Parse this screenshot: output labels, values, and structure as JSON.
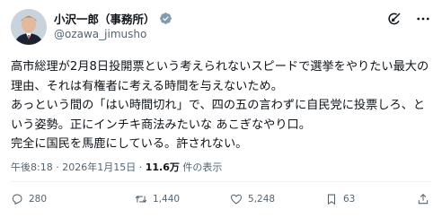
{
  "post": {
    "author_name": "小沢一郎（事務所）",
    "handle": "@ozawa_jimusho",
    "text": "高市総理が2月8日投開票という考えられないスピードで選挙をやりたい最大の理由、それは有権者に考える時間を与えないため。\nあっという間の「はい時間切れ」で、四の五の言わずに自民党に投票しろ、という姿勢。正にインチキ商法みたいな あこぎなやり口。\n完全に国民を馬鹿にしている。許されない。",
    "time": "午後8:18",
    "date": "2026年1月15日",
    "views_count": "11.6万",
    "views_suffix": "件の表示",
    "separator": "·"
  },
  "actions": {
    "replies": "280",
    "reposts": "1,440",
    "likes": "5,248",
    "bookmarks": "63"
  },
  "icons": [
    "verified-badge-icon",
    "grok-icon",
    "more-icon",
    "reply-icon",
    "repost-icon",
    "like-icon",
    "bookmark-icon",
    "share-icon"
  ],
  "colors": {
    "verified": "#829aab",
    "text": "#0f1419",
    "secondary": "#536471"
  }
}
